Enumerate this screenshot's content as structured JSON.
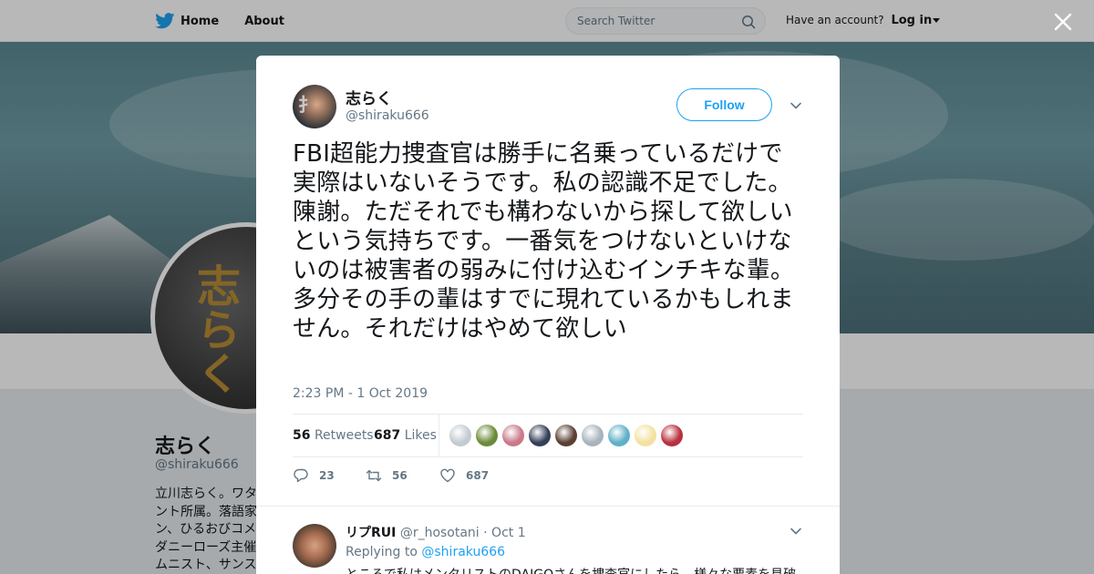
{
  "nav": {
    "home_label": "Home",
    "about_label": "About",
    "search_placeholder": "Search Twitter",
    "account_prompt": "Have an account?",
    "login_label": "Log in",
    "brand_color": "#1da1f2"
  },
  "profile": {
    "name": "志らく",
    "handle": "@shiraku666",
    "bio_lines": [
      "立川志らく。ワタ",
      "ント所属。落語家",
      "ン、ひるおびコメ",
      "ダニーローズ主催",
      "ムニスト、サンス"
    ]
  },
  "tweet": {
    "author_name": "志らく",
    "author_handle": "@shiraku666",
    "follow_label": "Follow",
    "text": "FBI超能力捜査官は勝手に名乗っているだけで実際はいないそうです。私の認識不足でした。陳謝。ただそれでも構わないから探して欲しいという気持ちです。一番気をつけないといけないのは被害者の弱みに付け込むインチキな輩。多分その手の輩はすでに現れているかもしれません。それだけはやめて欲しい",
    "timestamp": "2:23 PM - 1 Oct 2019",
    "retweets_count": "56",
    "retweets_label": "Retweets",
    "likes_count": "687",
    "likes_label": "Likes",
    "liker_avatar_colors": [
      "#c3cbd2",
      "#6b8a3a",
      "#c97a8a",
      "#34405a",
      "#5a4033",
      "#a9b3bb",
      "#5fb0c8",
      "#f3e1a0",
      "#b8303e"
    ],
    "actions": {
      "replies": "23",
      "retweets": "56",
      "likes": "687"
    }
  },
  "reply": {
    "name": "リプRUI",
    "handle": "@r_hosotani",
    "date": "· Oct 1",
    "replying_to_label": "Replying to",
    "replying_to_handle": "@shiraku666",
    "text": "ところで私はメンタリストのDAIGOさんを捜査官にしたら、様々な要素を見破"
  }
}
